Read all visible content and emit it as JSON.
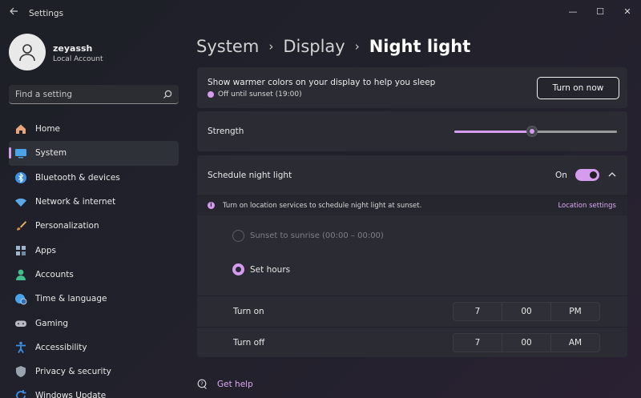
{
  "window": {
    "title": "Settings",
    "controls": {
      "minimize": "—",
      "maximize": "☐",
      "close": "✕"
    }
  },
  "profile": {
    "name": "zeyassh",
    "account_type": "Local Account"
  },
  "search": {
    "placeholder": "Find a setting"
  },
  "nav": {
    "items": [
      {
        "label": "Home",
        "icon": "home-icon",
        "color": "#e8a47a"
      },
      {
        "label": "System",
        "icon": "system-icon",
        "color": "#4aa3e8",
        "active": true
      },
      {
        "label": "Bluetooth & devices",
        "icon": "bluetooth-icon",
        "color": "#3b8fe6"
      },
      {
        "label": "Network & internet",
        "icon": "wifi-icon",
        "color": "#5aa9e6"
      },
      {
        "label": "Personalization",
        "icon": "brush-icon",
        "color": "#e8b06a"
      },
      {
        "label": "Apps",
        "icon": "apps-icon",
        "color": "#9fb6cc"
      },
      {
        "label": "Accounts",
        "icon": "person-icon",
        "color": "#3fbf8a"
      },
      {
        "label": "Time & language",
        "icon": "globe-clock-icon",
        "color": "#4aa3e8"
      },
      {
        "label": "Gaming",
        "icon": "gamepad-icon",
        "color": "#b9bcc4"
      },
      {
        "label": "Accessibility",
        "icon": "accessibility-icon",
        "color": "#3b8fe6"
      },
      {
        "label": "Privacy & security",
        "icon": "shield-icon",
        "color": "#9aa3ad"
      },
      {
        "label": "Windows Update",
        "icon": "update-icon",
        "color": "#3b8fe6"
      }
    ]
  },
  "breadcrumb": {
    "items": [
      "System",
      "Display"
    ],
    "current": "Night light",
    "separator": "›"
  },
  "night_light": {
    "description": "Show warmer colors on your display to help you sleep",
    "status": "Off until sunset (19:00)",
    "button_label": "Turn on now"
  },
  "strength": {
    "label": "Strength",
    "value": 0.48
  },
  "schedule": {
    "title": "Schedule night light",
    "toggle_state": "On",
    "location_notice": "Turn on location services to schedule night light at sunset.",
    "location_link": "Location settings",
    "option_sunset": "Sunset to sunrise (00:00 – 00:00)",
    "option_hours": "Set hours",
    "turn_on": {
      "label": "Turn on",
      "hour": "7",
      "minute": "00",
      "period": "PM"
    },
    "turn_off": {
      "label": "Turn off",
      "hour": "7",
      "minute": "00",
      "period": "AM"
    }
  },
  "help": {
    "label": "Get help"
  },
  "colors": {
    "accent": "#d59bef",
    "card": "#2a2b33",
    "background": "#1d2027"
  }
}
